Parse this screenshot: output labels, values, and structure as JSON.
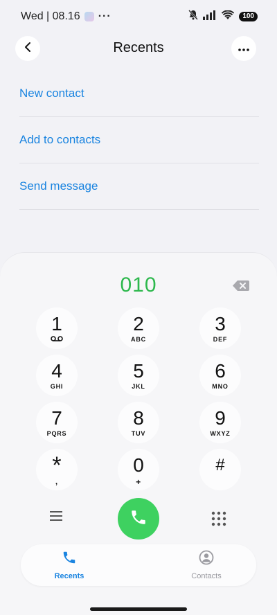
{
  "status": {
    "time": "Wed | 08.16",
    "more": "···",
    "battery": "100"
  },
  "header": {
    "title": "Recents"
  },
  "actions": [
    {
      "label": "New contact"
    },
    {
      "label": "Add to contacts"
    },
    {
      "label": "Send message"
    }
  ],
  "dialer": {
    "number": "010",
    "keys": [
      {
        "digit": "1",
        "sub": ""
      },
      {
        "digit": "2",
        "sub": "ABC"
      },
      {
        "digit": "3",
        "sub": "DEF"
      },
      {
        "digit": "4",
        "sub": "GHI"
      },
      {
        "digit": "5",
        "sub": "JKL"
      },
      {
        "digit": "6",
        "sub": "MNO"
      },
      {
        "digit": "7",
        "sub": "PQRS"
      },
      {
        "digit": "8",
        "sub": "TUV"
      },
      {
        "digit": "9",
        "sub": "WXYZ"
      },
      {
        "digit": "*",
        "sub": ","
      },
      {
        "digit": "0",
        "sub": "+"
      },
      {
        "digit": "#",
        "sub": ""
      }
    ]
  },
  "tabs": {
    "recents": "Recents",
    "contacts": "Contacts"
  },
  "colors": {
    "accent": "#1a84e0",
    "number": "#2db84d",
    "call": "#3ed160"
  }
}
